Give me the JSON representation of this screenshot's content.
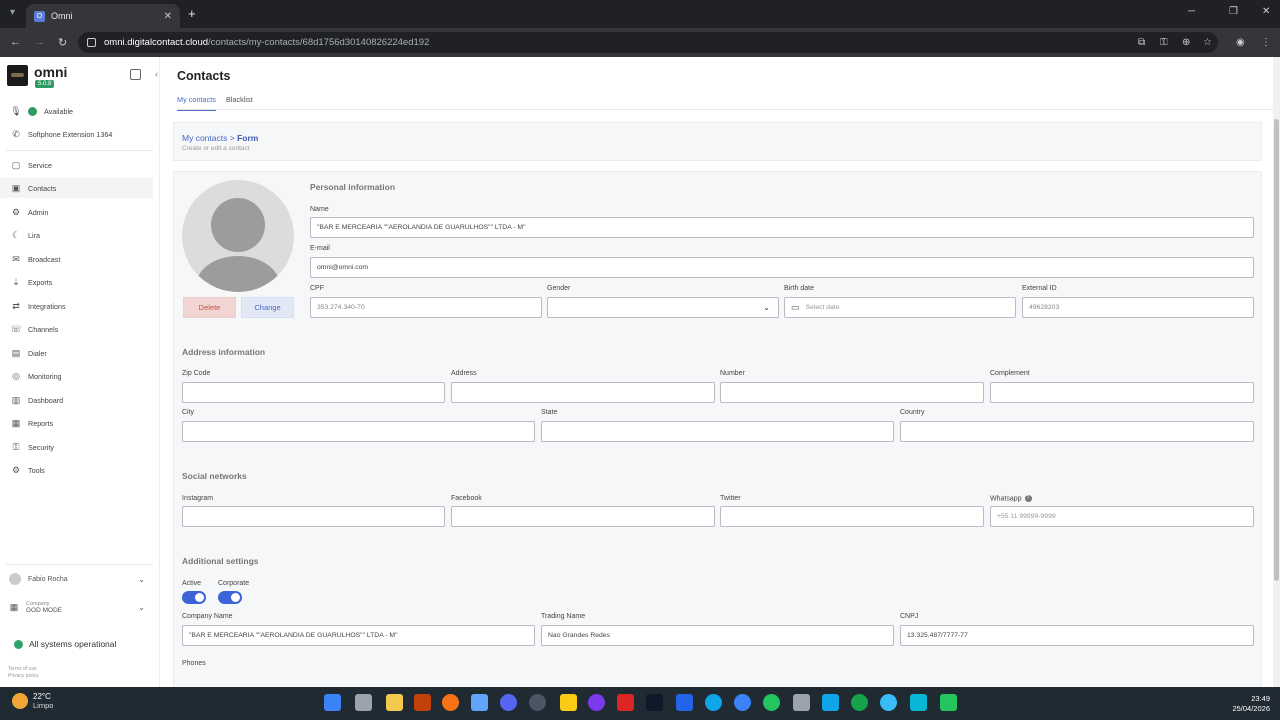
{
  "browser": {
    "tab_title": "Omni",
    "tab_favicon": "O",
    "url_host": "omni.digitalcontact.cloud",
    "url_path": "/contacts/my-contacts/68d1756d30140826224ed192"
  },
  "sidebar": {
    "brand": "omni",
    "version": "5.0.8",
    "status": "Available",
    "softphone": "Softphone Extension 1364",
    "items": [
      {
        "label": "Service",
        "icon": "service-icon"
      },
      {
        "label": "Contacts",
        "icon": "contacts-icon"
      },
      {
        "label": "Admin",
        "icon": "admin-icon"
      },
      {
        "label": "Lira",
        "icon": "lira-icon"
      },
      {
        "label": "Broadcast",
        "icon": "broadcast-icon"
      },
      {
        "label": "Exports",
        "icon": "exports-icon"
      },
      {
        "label": "Integrations",
        "icon": "integrations-icon"
      },
      {
        "label": "Channels",
        "icon": "channels-icon"
      },
      {
        "label": "Dialer",
        "icon": "dialer-icon"
      },
      {
        "label": "Monitoring",
        "icon": "monitoring-icon"
      },
      {
        "label": "Dashboard",
        "icon": "dashboard-icon"
      },
      {
        "label": "Reports",
        "icon": "reports-icon"
      },
      {
        "label": "Security",
        "icon": "security-icon"
      },
      {
        "label": "Tools",
        "icon": "tools-icon"
      }
    ],
    "user_name": "Fabio Rocha",
    "company_label": "Company",
    "company_value": "GOD MODE",
    "system_status": "All systems operational",
    "terms": "Terms of use",
    "privacy": "Privacy policy"
  },
  "page": {
    "title": "Contacts",
    "tabs": [
      "My contacts",
      "Blacklist"
    ],
    "breadcrumb_parent": "My contacts",
    "breadcrumb_sep": ">",
    "breadcrumb_current": "Form",
    "breadcrumb_sub": "Create or edit a contact"
  },
  "avatar": {
    "delete_label": "Delete",
    "change_label": "Change"
  },
  "personal": {
    "title": "Personal information",
    "name_label": "Name",
    "name_value": "\"BAR E MERCEARIA \"\"AEROLANDIA DE GUARULHOS\"\" LTDA - M\"",
    "email_label": "E-mail",
    "email_value": "omni@omni.com",
    "cpf_label": "CPF",
    "cpf_value": "353.274.340-70",
    "gender_label": "Gender",
    "gender_value": "",
    "birth_label": "Birth date",
    "birth_placeholder": "Select date",
    "external_label": "External ID",
    "external_value": "49628203"
  },
  "address": {
    "title": "Address information",
    "zip_label": "Zip Code",
    "address_label": "Address",
    "number_label": "Number",
    "complement_label": "Complement",
    "city_label": "City",
    "state_label": "State",
    "country_label": "Country"
  },
  "social": {
    "title": "Social networks",
    "instagram_label": "Instagram",
    "facebook_label": "Facebook",
    "twitter_label": "Twitter",
    "whatsapp_label": "Whatsapp",
    "whatsapp_placeholder": "+55 11 99999-9999"
  },
  "additional": {
    "title": "Additional settings",
    "active_label": "Active",
    "active_on": true,
    "corporate_label": "Corporate",
    "corporate_on": true,
    "company_name_label": "Company Name",
    "company_name_value": "\"BAR E MERCEARIA \"\"AEROLANDIA DE GUARULHOS\"\" LTDA - M\"",
    "trading_name_label": "Trading Name",
    "trading_name_value": "Nao Grandes Redes",
    "cnpj_label": "CNPJ",
    "cnpj_value": "13.325.487/7777-77",
    "phones_label": "Phones"
  },
  "taskbar": {
    "temperature": "22°C",
    "weather": "Limpo",
    "time": "23:49",
    "date": "25/04/2026"
  },
  "colors": {
    "accent": "#4a68c4",
    "status_green": "#2e9b63",
    "toggle_blue": "#3c64d8",
    "delete_bg": "#f2d5d2"
  }
}
